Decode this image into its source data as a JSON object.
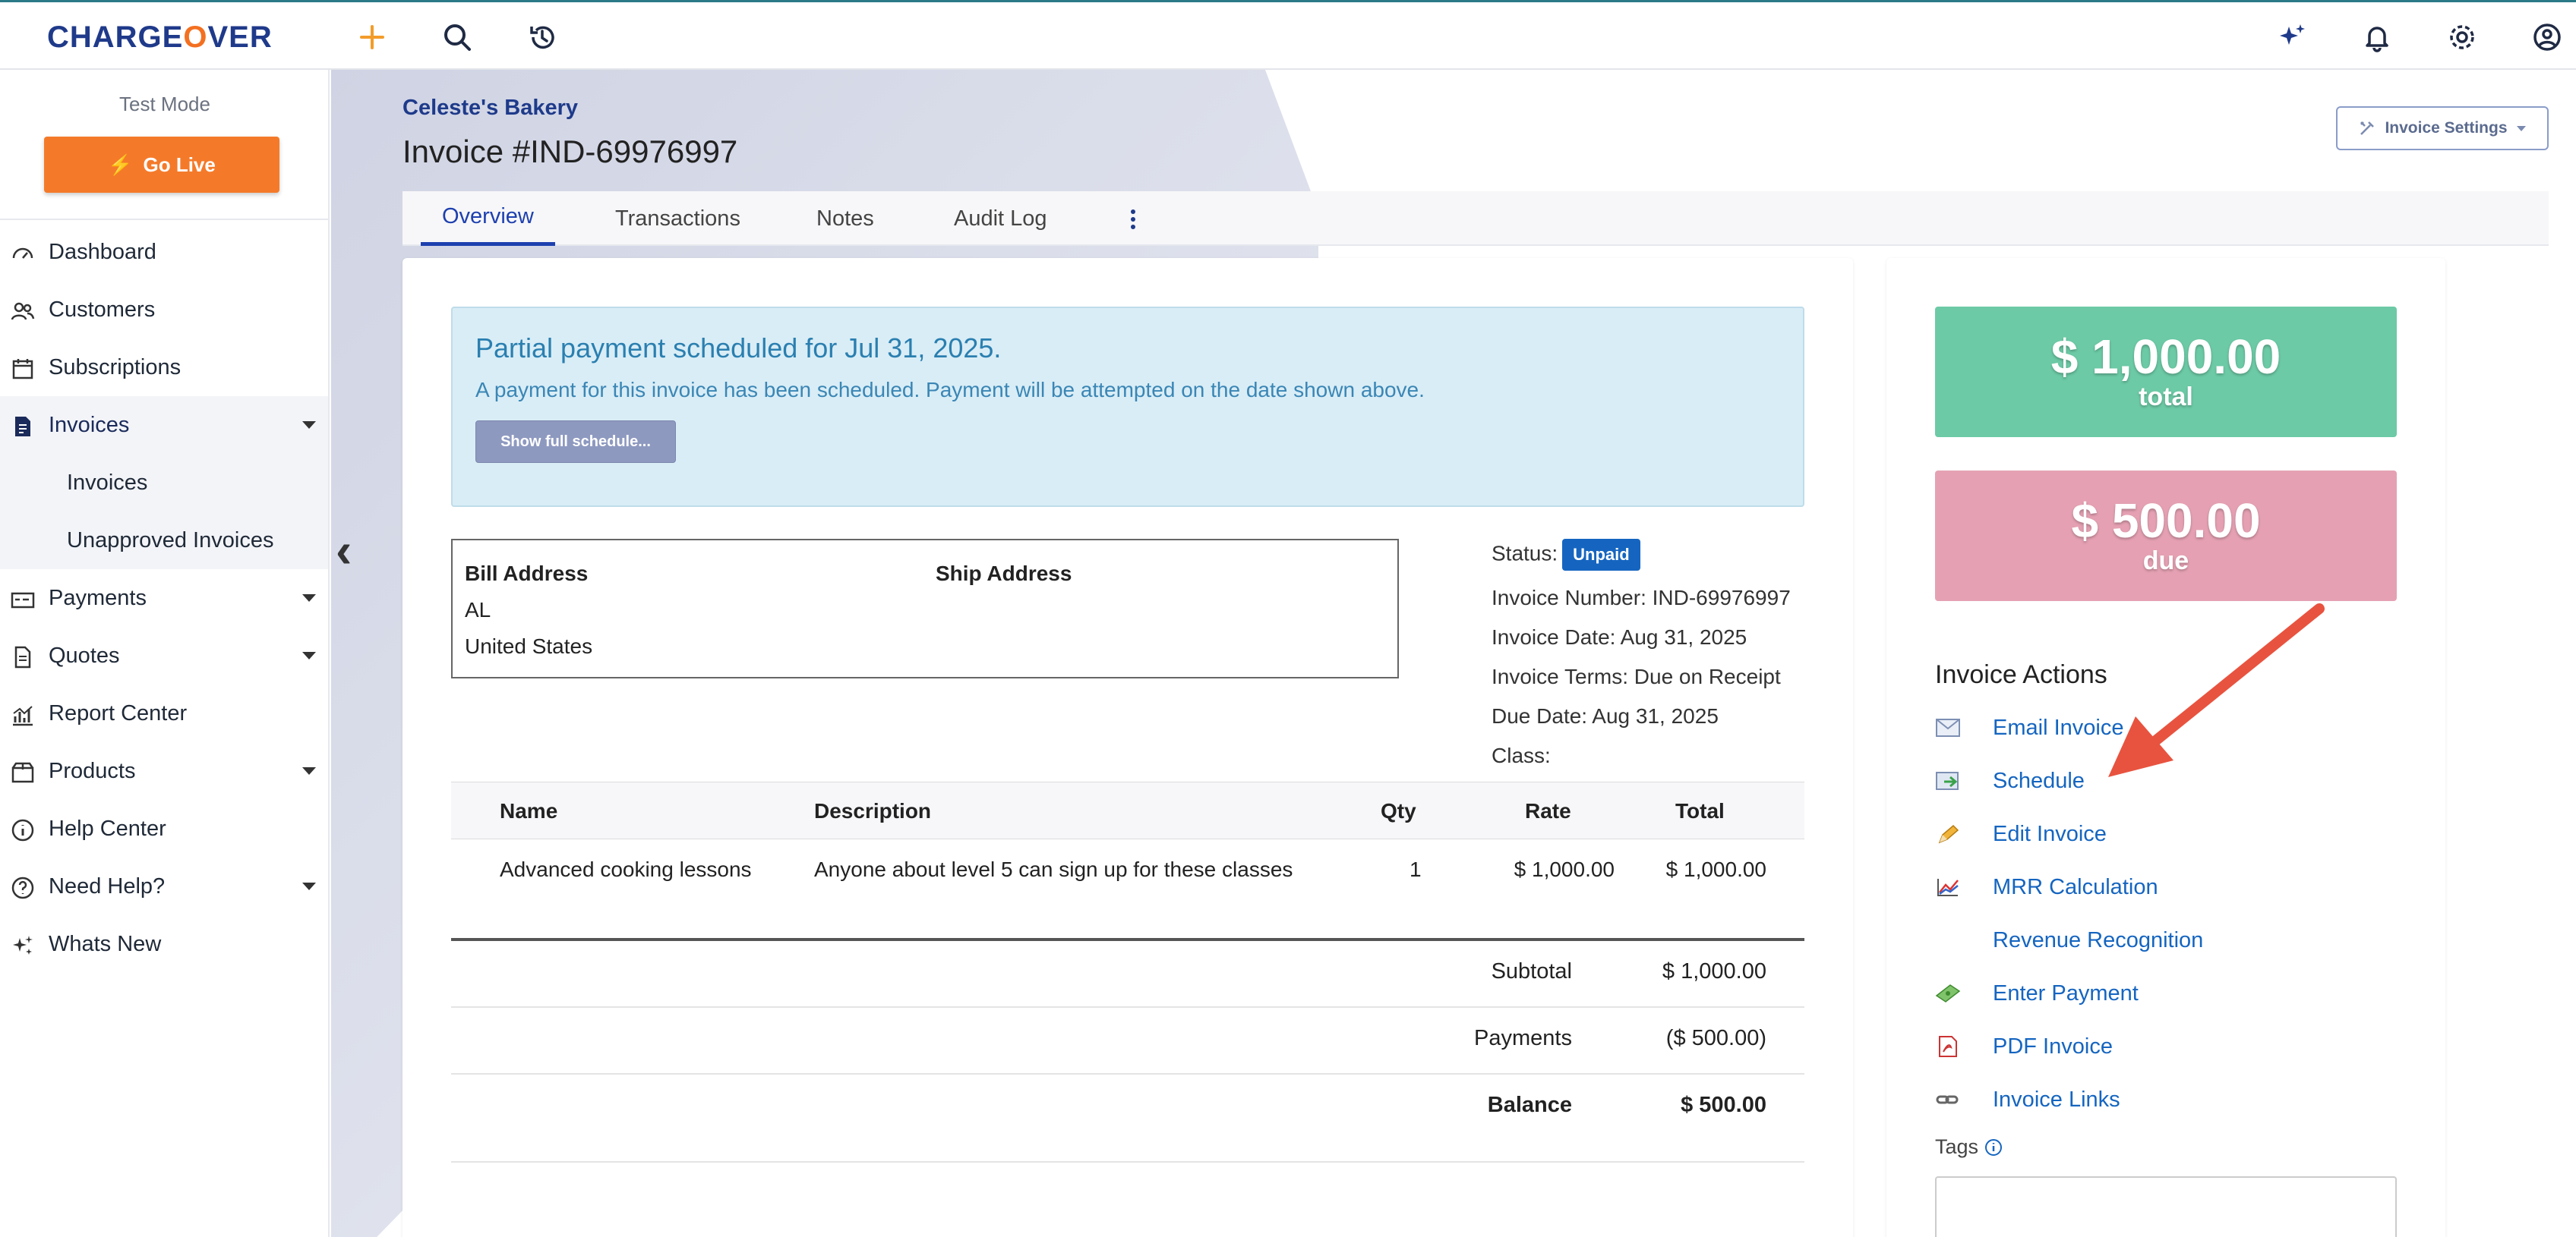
{
  "app": {
    "logo": {
      "pre": "CHARGE",
      "o": "O",
      "post": "VER"
    }
  },
  "sidebar": {
    "test_mode": "Test Mode",
    "go_live": "Go Live",
    "items": [
      {
        "label": "Dashboard",
        "icon": "speedometer-icon"
      },
      {
        "label": "Customers",
        "icon": "users-icon"
      },
      {
        "label": "Subscriptions",
        "icon": "calendar-icon"
      },
      {
        "label": "Invoices",
        "icon": "invoice-icon"
      },
      {
        "label": "Invoices"
      },
      {
        "label": "Unapproved Invoices"
      },
      {
        "label": "Payments",
        "icon": "payment-card-icon"
      },
      {
        "label": "Quotes",
        "icon": "document-icon"
      },
      {
        "label": "Report Center",
        "icon": "chart-icon"
      },
      {
        "label": "Products",
        "icon": "box-icon"
      },
      {
        "label": "Help Center",
        "icon": "info-icon"
      },
      {
        "label": "Need Help?",
        "icon": "question-icon"
      },
      {
        "label": "Whats New",
        "icon": "sparkle-icon"
      }
    ]
  },
  "header": {
    "company": "Celeste's Bakery",
    "title": "Invoice #IND-69976997",
    "settings_button": "Invoice Settings"
  },
  "tabs": [
    "Overview",
    "Transactions",
    "Notes",
    "Audit Log"
  ],
  "notice": {
    "title": "Partial payment scheduled for Jul 31, 2025.",
    "text": "A payment for this invoice has been scheduled. Payment will be attempted on the date shown above.",
    "button": "Show full schedule..."
  },
  "address": {
    "bill_heading": "Bill Address",
    "ship_heading": "Ship Address",
    "bill_line1": "AL",
    "bill_line2": "United States"
  },
  "details": {
    "status_label": "Status:",
    "status_value": "Unpaid",
    "invoice_number": "Invoice Number: IND-69976997",
    "invoice_date": "Invoice Date: Aug 31, 2025",
    "invoice_terms": "Invoice Terms: Due on Receipt",
    "due_date": "Due Date: Aug 31, 2025",
    "class": "Class:"
  },
  "line_items": {
    "headers": [
      "Name",
      "Description",
      "Qty",
      "Rate",
      "Total"
    ],
    "rows": [
      {
        "name": "Advanced cooking lessons",
        "description": "Anyone about level 5 can sign up for these classes",
        "qty": "1",
        "rate": "$ 1,000.00",
        "total": "$ 1,000.00"
      }
    ]
  },
  "totals": {
    "subtotal_label": "Subtotal",
    "subtotal": "$ 1,000.00",
    "payments_label": "Payments",
    "payments": "($ 500.00)",
    "balance_label": "Balance",
    "balance": "$ 500.00"
  },
  "summary": {
    "total_amount": "$ 1,000.00",
    "total_label": "total",
    "due_amount": "$ 500.00",
    "due_label": "due",
    "total_color": "#6ccaa6",
    "due_color": "#e5a1b3"
  },
  "actions": {
    "title": "Invoice Actions",
    "items": [
      {
        "label": "Email Invoice",
        "icon": "envelope-icon"
      },
      {
        "label": "Schedule",
        "icon": "schedule-icon"
      },
      {
        "label": "Edit Invoice",
        "icon": "pencil-icon"
      },
      {
        "label": "MRR Calculation",
        "icon": "mrr-chart-icon"
      },
      {
        "label": "Revenue Recognition",
        "icon": ""
      },
      {
        "label": "Enter Payment",
        "icon": "money-icon"
      },
      {
        "label": "PDF Invoice",
        "icon": "pdf-icon"
      },
      {
        "label": "Invoice Links",
        "icon": "link-icon"
      }
    ]
  },
  "tags_label": "Tags",
  "colors": {
    "brand": "#1f3a8a",
    "accent": "#f37021",
    "link": "#1565c0",
    "arrow": "#e8533f"
  }
}
